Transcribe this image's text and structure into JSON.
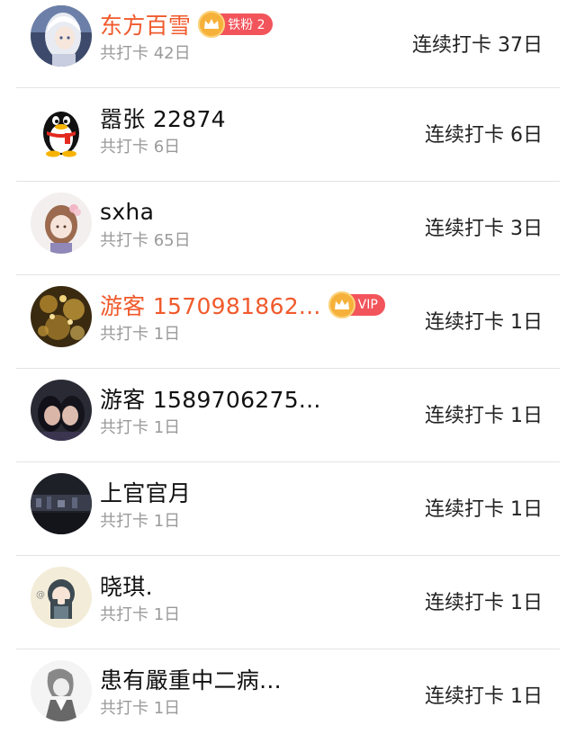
{
  "rows": [
    {
      "name": "东方百雪",
      "highlight": true,
      "badge": {
        "label": "铁粉 2"
      },
      "total": "共打卡 42日",
      "streak": "连续打卡 37日",
      "avatar": "anime-girl-white-hair-avatar"
    },
    {
      "name": "嚣张 22874",
      "highlight": false,
      "badge": null,
      "total": "共打卡 6日",
      "streak": "连续打卡 6日",
      "avatar": "qq-penguin-avatar"
    },
    {
      "name": "sxha",
      "highlight": false,
      "badge": null,
      "total": "共打卡 65日",
      "streak": "连续打卡 3日",
      "avatar": "anime-girl-flower-avatar"
    },
    {
      "name": "游客 1570981862...",
      "highlight": true,
      "badge": {
        "label": "VIP"
      },
      "total": "共打卡 1日",
      "streak": "连续打卡 1日",
      "avatar": "golden-lights-avatar"
    },
    {
      "name": "游客 1589706275...",
      "highlight": false,
      "badge": null,
      "total": "共打卡 1日",
      "streak": "连续打卡 1日",
      "avatar": "two-girls-photo-avatar"
    },
    {
      "name": "上官官月",
      "highlight": false,
      "badge": null,
      "total": "共打卡 1日",
      "streak": "连续打卡 1日",
      "avatar": "dark-cityscape-avatar"
    },
    {
      "name": "晓琪.",
      "highlight": false,
      "badge": null,
      "total": "共打卡 1日",
      "streak": "连续打卡 1日",
      "avatar": "chibi-girl-avatar"
    },
    {
      "name": "患有嚴重中二病...",
      "highlight": false,
      "badge": null,
      "total": "共打卡 1日",
      "streak": "连续打卡 1日",
      "avatar": "sketch-figure-avatar"
    }
  ],
  "colors": {
    "highlight_name": "#f05a2c",
    "badge_bg": "#f2545b",
    "crown": "#f6b13b",
    "secondary_text": "#9a9a9a",
    "divider": "#e3e3e3"
  }
}
